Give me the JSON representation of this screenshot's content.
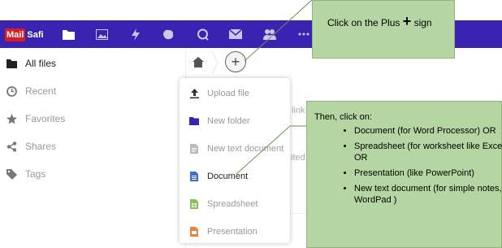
{
  "topbar": {
    "logo_mail": "Mail",
    "logo_rest": "Safi",
    "apps": [
      "files-icon",
      "photos-icon",
      "activity-icon",
      "settings-app-icon",
      "talk-icon",
      "mail-icon",
      "contacts-icon",
      "more-icon"
    ],
    "background": "#3a23b0"
  },
  "sidebar": {
    "items": [
      {
        "label": "All files",
        "icon": "folder-icon"
      },
      {
        "label": "Recent",
        "icon": "clock-icon"
      },
      {
        "label": "Favorites",
        "icon": "star-icon"
      },
      {
        "label": "Shares",
        "icon": "share-icon"
      },
      {
        "label": "Tags",
        "icon": "tag-icon"
      }
    ]
  },
  "breadcrumb": {
    "plus_label": "+"
  },
  "background_fragments": [
    "link",
    "ited"
  ],
  "new_menu": {
    "items": [
      {
        "label": "Upload file",
        "icon": "upload-icon"
      },
      {
        "label": "New folder",
        "icon": "folder-icon"
      },
      {
        "label": "New text document",
        "icon": "text-doc-icon"
      },
      {
        "label": "Document",
        "icon": "document-icon"
      },
      {
        "label": "Spreadsheet",
        "icon": "spreadsheet-icon"
      },
      {
        "label": "Presentation",
        "icon": "presentation-icon"
      }
    ]
  },
  "callouts": {
    "first": {
      "text": "Click on the Plus",
      "plus": "+",
      "suffix": " sign"
    },
    "second": {
      "heading": "Then, click on:",
      "bullets": [
        "Document (for Word Processor) OR",
        "Spreadsheet (for worksheet like Excel) OR",
        "Presentation (like PowerPoint)",
        "New text document (for simple notes, like WordPad )"
      ]
    },
    "fill_color": "#b5d6a2"
  }
}
